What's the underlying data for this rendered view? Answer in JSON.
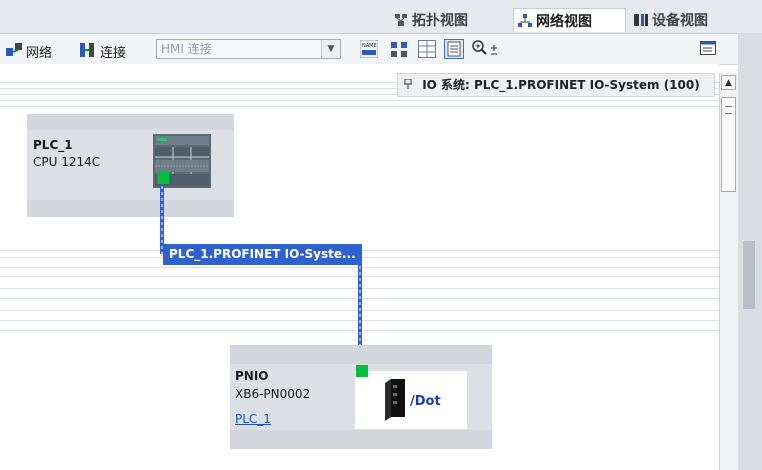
{
  "view_tabs": [
    {
      "label": "拓扑视图",
      "active": false
    },
    {
      "label": "网络视图",
      "active": true
    },
    {
      "label": "设备视图",
      "active": false
    }
  ],
  "toolbar": {
    "network_label": "网络",
    "connection_label": "连接",
    "connection_type_placeholder": "HMI 连接"
  },
  "io_system_bar": "IO 系统: PLC_1.PROFINET IO-System (100)",
  "devices": {
    "plc": {
      "name": "PLC_1",
      "type": "CPU 1214C"
    },
    "pnio": {
      "name": "PNIO",
      "type": "XB6-PN0002",
      "assigned_controller": "PLC_1",
      "logo_text": "/Dot"
    }
  },
  "network_label": "PLC_1.PROFINET IO-Syste...",
  "colors": {
    "network_blue": "#2f62cf",
    "port_green": "#00c03d",
    "device_bg": "#dcdfe4"
  },
  "icons": [
    "topology-icon",
    "network-icon",
    "device-icon",
    "network-view-icon",
    "connections-icon",
    "name-icon",
    "grid-icon",
    "table-icon",
    "zoom-icon",
    "panel-icon"
  ]
}
